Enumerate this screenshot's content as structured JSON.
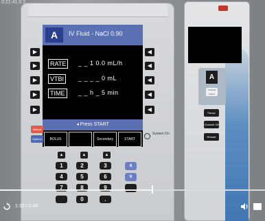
{
  "top_label": "0:21:41 0 2",
  "pump": {
    "channel": "A",
    "title": "IV Fluid - NaCl 0.90",
    "rows": [
      {
        "label": "RATE",
        "value": "_ _ 1 0.0 mL/h"
      },
      {
        "label": "VTBI",
        "value": "_ _ _ _ 0 mL"
      },
      {
        "label": "TIME",
        "value": "_ _ h _ 5 min"
      }
    ],
    "prompt": "◂ Press START",
    "softkeys": [
      "BOLUS",
      "",
      "Secondary",
      "START"
    ],
    "silence_label": "Silence",
    "options_label": "Options",
    "system_on_label": "System On",
    "keypad": [
      "1",
      "2",
      "3",
      "4",
      "5",
      "6",
      "7",
      "8",
      "9",
      "",
      "0",
      "."
    ],
    "nav_up": "∧",
    "nav_down": "∨",
    "side_arrow_left": "▶",
    "side_arrow_right": "◀"
  },
  "module": {
    "channel": "A",
    "channel_select_label": "Channel Select",
    "pause_label": "Pause",
    "channel_off_label": "Channel Off",
    "restart_label": "Restart",
    "latch_color": "#c0392b"
  },
  "player": {
    "time": "1:32 / 2:48",
    "progress": 0.574,
    "replay_icon": "replay-icon",
    "volume_icon": "volume-icon",
    "fullscreen_icon": "fullscreen-icon"
  }
}
